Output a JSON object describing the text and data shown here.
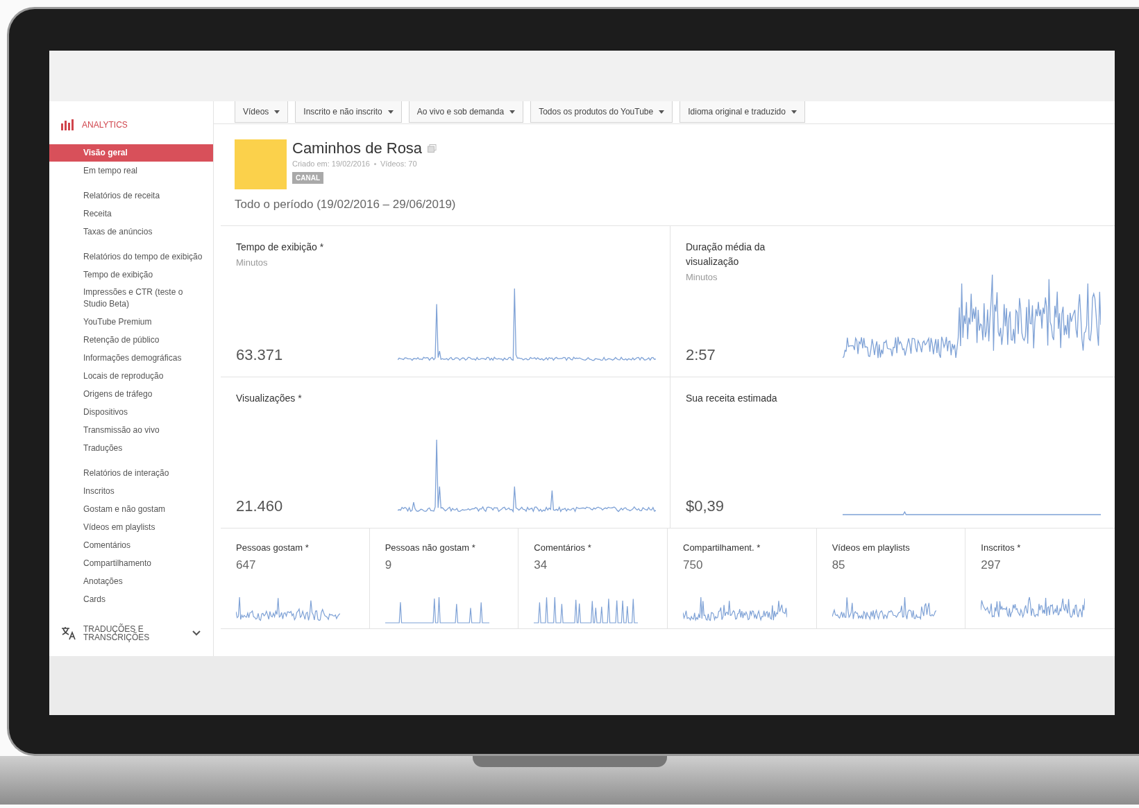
{
  "sidebar": {
    "title": "ANALYTICS",
    "sections": [
      {
        "items": [
          {
            "label": "Visão geral",
            "selected": true
          },
          {
            "label": "Em tempo real",
            "selected": false
          }
        ]
      },
      {
        "items": [
          {
            "label": "Relatórios de receita",
            "selected": false
          },
          {
            "label": "Receita",
            "selected": false
          },
          {
            "label": "Taxas de anúncios",
            "selected": false
          }
        ]
      },
      {
        "items": [
          {
            "label": "Relatórios do tempo de exibição",
            "selected": false
          },
          {
            "label": "Tempo de exibição",
            "selected": false
          },
          {
            "label": "Impressões e CTR (teste o Studio Beta)",
            "selected": false
          },
          {
            "label": "YouTube Premium",
            "selected": false
          },
          {
            "label": "Retenção de público",
            "selected": false
          },
          {
            "label": "Informações demográficas",
            "selected": false
          },
          {
            "label": "Locais de reprodução",
            "selected": false
          },
          {
            "label": "Origens de tráfego",
            "selected": false
          },
          {
            "label": "Dispositivos",
            "selected": false
          },
          {
            "label": "Transmissão ao vivo",
            "selected": false
          },
          {
            "label": "Traduções",
            "selected": false
          }
        ]
      },
      {
        "items": [
          {
            "label": "Relatórios de interação",
            "selected": false
          },
          {
            "label": "Inscritos",
            "selected": false
          },
          {
            "label": "Gostam e não gostam",
            "selected": false
          },
          {
            "label": "Vídeos em playlists",
            "selected": false
          },
          {
            "label": "Comentários",
            "selected": false
          },
          {
            "label": "Compartilhamento",
            "selected": false
          },
          {
            "label": "Anotações",
            "selected": false
          },
          {
            "label": "Cards",
            "selected": false
          }
        ]
      }
    ],
    "footer": {
      "label": "TRADUÇÕES E TRANSCRIÇÕES",
      "expanded": false
    }
  },
  "filters": [
    "Vídeos",
    "Inscrito e não inscrito",
    "Ao vivo e sob demanda",
    "Todos os produtos do YouTube",
    "Idioma original e traduzido"
  ],
  "channel": {
    "name": "Caminhos de Rosa",
    "created": "Criado em: 19/02/2016",
    "videos": "Vídeos: 70",
    "badge": "CANAL",
    "period": "Todo o período (19/02/2016 – 29/06/2019)"
  },
  "metrics": [
    {
      "title": "Tempo de exibição *",
      "subtitle": "Minutos",
      "value": "63.371"
    },
    {
      "title": "Duração média da visualização",
      "subtitle": "Minutos",
      "value": "2:57"
    },
    {
      "title": "Visualizações *",
      "value": "21.460"
    },
    {
      "title": "Sua receita estimada",
      "value": "$0,39"
    }
  ],
  "small_metrics": [
    {
      "title": "Pessoas gostam *",
      "value": "647"
    },
    {
      "title": "Pessoas não gostam *",
      "value": "9"
    },
    {
      "title": "Comentários *",
      "value": "34"
    },
    {
      "title": "Compartilhament. *",
      "value": "750"
    },
    {
      "title": "Vídeos em playlists",
      "value": "85"
    },
    {
      "title": "Inscritos *",
      "value": "297"
    }
  ]
}
